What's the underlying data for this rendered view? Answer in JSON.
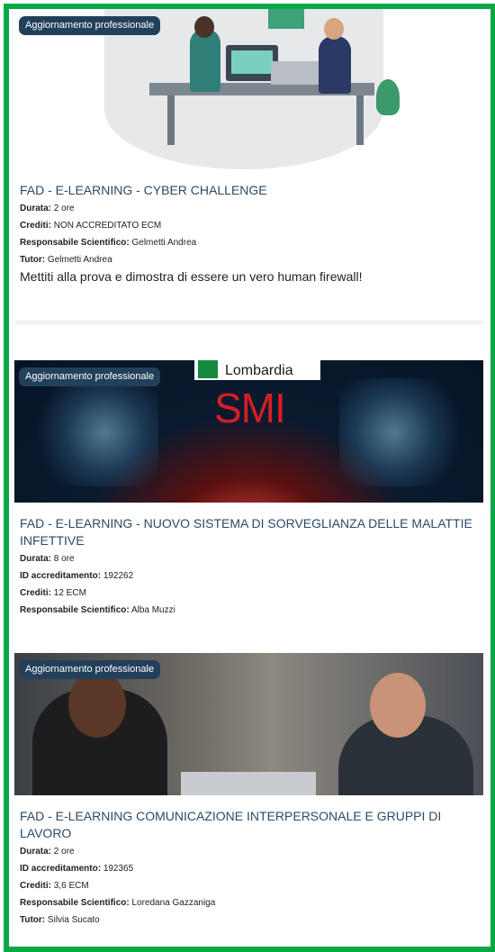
{
  "cards": [
    {
      "badge": "Aggiornamento professionale",
      "title": "FAD - E-LEARNING - CYBER CHALLENGE",
      "meta": [
        {
          "label": "Durata:",
          "value": "2 ore"
        },
        {
          "label": "Crediti:",
          "value": "NON ACCREDITATO ECM"
        },
        {
          "label": "Responsabile Scientifico:",
          "value": "Gelmetti Andrea"
        },
        {
          "label": "Tutor:",
          "value": "Gelmetti Andrea"
        }
      ],
      "description": "Mettiti alla prova e dimostra di essere un vero human firewall!"
    },
    {
      "badge": "Aggiornamento professionale",
      "image_text": {
        "region": "Lombardia",
        "logo": "SMI"
      },
      "title_line1": "FAD - E-LEARNING - NUOVO SISTEMA DI SORVEGLIANZA DELLE MALATTIE",
      "title_line2": "INFETTIVE",
      "meta": [
        {
          "label": "Durata:",
          "value": "8 ore"
        },
        {
          "label": "ID accreditamento:",
          "value": "192262"
        },
        {
          "label": "Crediti:",
          "value": "12 ECM"
        },
        {
          "label": "Responsabile Scientifico:",
          "value": "Alba Muzzi"
        }
      ]
    },
    {
      "badge": "Aggiornamento professionale",
      "title_line1": "FAD - E-LEARNING COMUNICAZIONE INTERPERSONALE E GRUPPI DI",
      "title_line2": "LAVORO",
      "meta": [
        {
          "label": "Durata:",
          "value": "2 ore"
        },
        {
          "label": "ID accreditamento:",
          "value": "192365"
        },
        {
          "label": "Crediti:",
          "value": "3,6 ECM"
        },
        {
          "label": "Responsabile Scientifico:",
          "value": "Loredana Gazzaniga"
        },
        {
          "label": "Tutor:",
          "value": "Silvia Sucato"
        }
      ]
    }
  ],
  "colors": {
    "border": "#0aa845",
    "badge_bg": "#22405a",
    "title": "#2d4a66"
  }
}
